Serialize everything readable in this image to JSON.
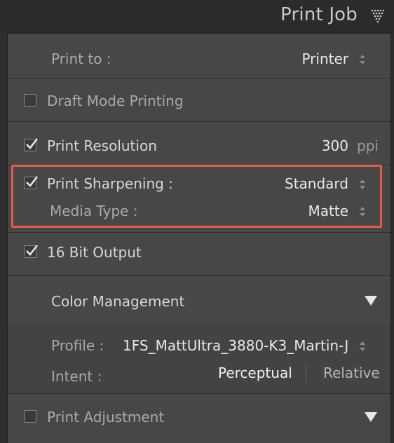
{
  "header": {
    "title": "Print Job",
    "icon": "panel-collapse-icon"
  },
  "print_to": {
    "label": "Print to :",
    "value": "Printer"
  },
  "draft_mode": {
    "label": "Draft Mode Printing",
    "checked": false
  },
  "print_resolution": {
    "label": "Print Resolution",
    "checked": true,
    "value": "300",
    "unit": "ppi"
  },
  "print_sharpening": {
    "label": "Print Sharpening :",
    "checked": true,
    "value": "Standard"
  },
  "media_type": {
    "label": "Media Type :",
    "value": "Matte"
  },
  "bit_output": {
    "label": "16 Bit Output",
    "checked": true
  },
  "color_management": {
    "title": "Color Management",
    "profile_label": "Profile :",
    "profile_value": "1FS_MattUltra_3880-K3_Martin-J",
    "intent_label": "Intent :",
    "intent_options": [
      "Perceptual",
      "Relative"
    ],
    "intent_selected": "Perceptual"
  },
  "print_adjustment": {
    "label": "Print Adjustment",
    "checked": false
  },
  "colors": {
    "highlight": "#e9584d"
  }
}
